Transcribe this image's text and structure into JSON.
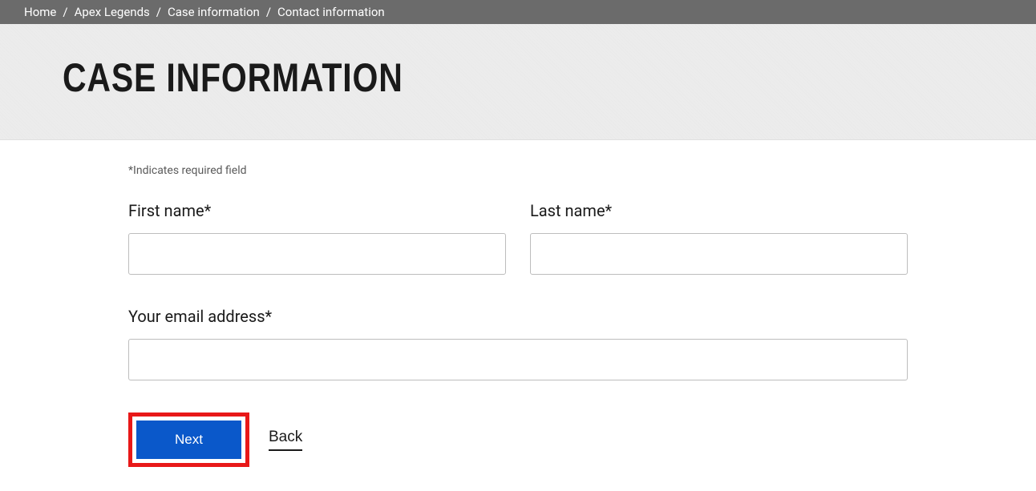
{
  "breadcrumb": {
    "items": [
      "Home",
      "Apex Legends",
      "Case information",
      "Contact information"
    ],
    "separator": "/"
  },
  "page_title": "CASE INFORMATION",
  "form": {
    "required_note": "*Indicates required field",
    "first_name": {
      "label": "First name*",
      "value": ""
    },
    "last_name": {
      "label": "Last name*",
      "value": ""
    },
    "email": {
      "label": "Your email address*",
      "value": ""
    }
  },
  "buttons": {
    "next": "Next",
    "back": "Back"
  }
}
